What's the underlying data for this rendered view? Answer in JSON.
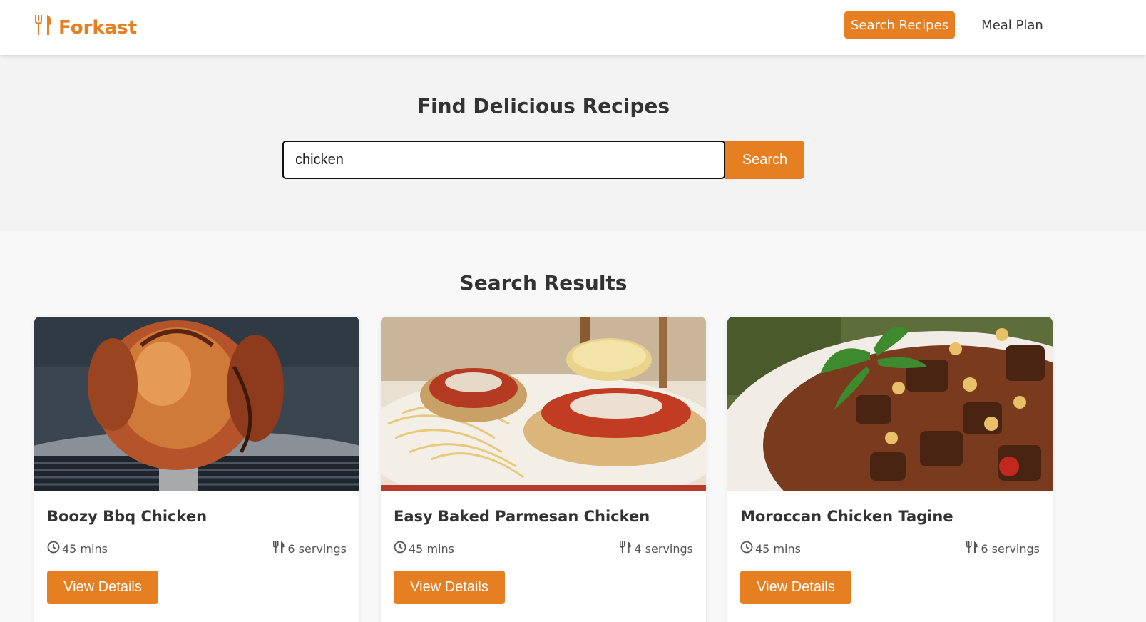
{
  "brand": {
    "name": "Forkast",
    "icon": "utensils-icon",
    "color": "#e67e22"
  },
  "nav": {
    "active_label": "Search Recipes",
    "meal_plan_label": "Meal Plan"
  },
  "hero": {
    "title": "Find Delicious Recipes",
    "search_value": "chicken",
    "search_button": "Search"
  },
  "results": {
    "title": "Search Results",
    "cards": [
      {
        "title": "Boozy Bbq Chicken",
        "time": "45 mins",
        "servings": "6 servings",
        "button": "View Details",
        "image": "roasted-chicken-on-grill"
      },
      {
        "title": "Easy Baked Parmesan Chicken",
        "time": "45 mins",
        "servings": "4 servings",
        "button": "View Details",
        "image": "chicken-parmesan-with-spaghetti"
      },
      {
        "title": "Moroccan Chicken Tagine",
        "time": "45 mins",
        "servings": "6 servings",
        "button": "View Details",
        "image": "chicken-tagine-stew"
      }
    ]
  },
  "icons": {
    "time": "clock-icon",
    "servings": "utensils-icon"
  },
  "colors": {
    "accent": "#e67e22",
    "text": "#333333",
    "hero_bg": "#f3f3f3",
    "page_bg": "#f8f8f8"
  }
}
